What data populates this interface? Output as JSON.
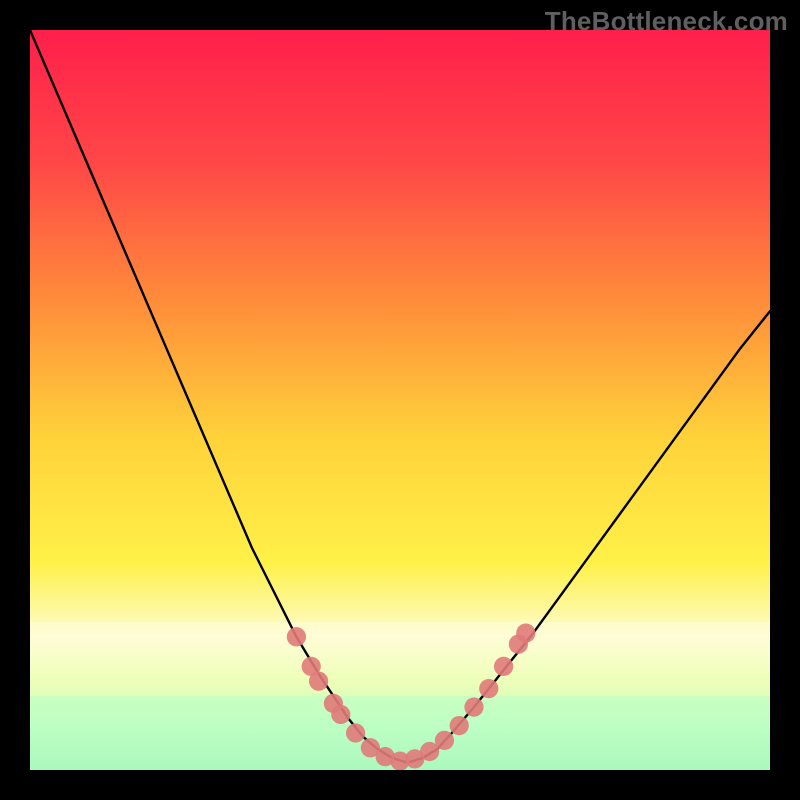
{
  "watermark": "TheBottleneck.com",
  "chart_data": {
    "type": "line",
    "title": "",
    "xlabel": "",
    "ylabel": "",
    "xlim": [
      0,
      100
    ],
    "ylim": [
      0,
      100
    ],
    "grid": false,
    "legend": false,
    "background_gradient_stops": [
      {
        "offset": 0.0,
        "color": "#ff1f4b"
      },
      {
        "offset": 0.18,
        "color": "#ff4747"
      },
      {
        "offset": 0.36,
        "color": "#ff8a3a"
      },
      {
        "offset": 0.55,
        "color": "#ffd23a"
      },
      {
        "offset": 0.72,
        "color": "#fff148"
      },
      {
        "offset": 0.82,
        "color": "#fdfccf"
      },
      {
        "offset": 0.88,
        "color": "#d7ff8f"
      },
      {
        "offset": 0.94,
        "color": "#7dff9a"
      },
      {
        "offset": 1.0,
        "color": "#22e07e"
      }
    ],
    "series": [
      {
        "name": "curve",
        "color": "#000000",
        "x": [
          0,
          3,
          6,
          9,
          12,
          15,
          18,
          21,
          24,
          27,
          30,
          33,
          36,
          39,
          41,
          43,
          45,
          47,
          49,
          51,
          53,
          55,
          57,
          60,
          64,
          68,
          72,
          76,
          80,
          84,
          88,
          92,
          96,
          100
        ],
        "y": [
          100,
          93,
          86,
          79,
          72,
          65,
          58,
          51,
          44,
          37,
          30,
          24,
          18,
          13,
          10,
          7,
          4.5,
          2.8,
          1.6,
          1.0,
          1.6,
          2.8,
          5.0,
          8.5,
          13.5,
          18.5,
          24.0,
          29.5,
          35.0,
          40.5,
          46.0,
          51.5,
          57.0,
          62.0
        ]
      }
    ],
    "markers": {
      "color": "#e07a7a",
      "radius": 1.3,
      "points": [
        {
          "x": 36,
          "y": 18
        },
        {
          "x": 38,
          "y": 14
        },
        {
          "x": 39,
          "y": 12
        },
        {
          "x": 41,
          "y": 9
        },
        {
          "x": 42,
          "y": 7.5
        },
        {
          "x": 44,
          "y": 5
        },
        {
          "x": 46,
          "y": 3
        },
        {
          "x": 48,
          "y": 1.8
        },
        {
          "x": 50,
          "y": 1.2
        },
        {
          "x": 52,
          "y": 1.5
        },
        {
          "x": 54,
          "y": 2.5
        },
        {
          "x": 56,
          "y": 4.0
        },
        {
          "x": 58,
          "y": 6.0
        },
        {
          "x": 60,
          "y": 8.5
        },
        {
          "x": 62,
          "y": 11.0
        },
        {
          "x": 64,
          "y": 14.0
        },
        {
          "x": 66,
          "y": 17.0
        },
        {
          "x": 67,
          "y": 18.5
        }
      ]
    },
    "bottom_bands": [
      {
        "y_top": 20,
        "color": "#fffddb",
        "opacity": 0.55
      },
      {
        "y_top": 10,
        "color": "#b8ffc8",
        "opacity": 0.55
      }
    ]
  }
}
